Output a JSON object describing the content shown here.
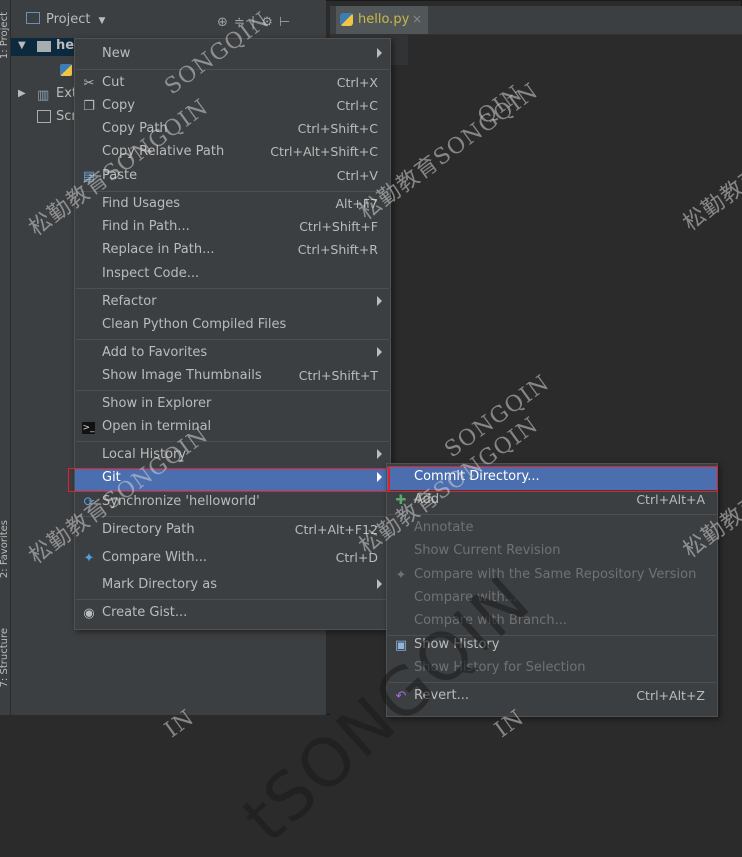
{
  "project_panel": {
    "title": "Project",
    "dropdown_glyph": "▼",
    "side_label_top": "1: Project",
    "side_label_favorites": "2: Favorites",
    "side_label_structure": "7: Structure",
    "tree": [
      {
        "label": "hel",
        "expand": "▼"
      },
      {
        "label": "Ext",
        "expand": "▶"
      },
      {
        "label": "Scr",
        "expand": ""
      }
    ]
  },
  "editor": {
    "tab_label": "hello.py",
    "tab_close": "×"
  },
  "context_menu": {
    "items": [
      {
        "label": "New",
        "shortcut": "",
        "submenu": true,
        "icon": ""
      },
      {
        "label": "Cut",
        "shortcut": "Ctrl+X",
        "icon": "cut-icon"
      },
      {
        "label": "Copy",
        "shortcut": "Ctrl+C",
        "icon": "copy-icon"
      },
      {
        "label": "Copy Path",
        "shortcut": "Ctrl+Shift+C",
        "icon": ""
      },
      {
        "label": "Copy Relative Path",
        "shortcut": "Ctrl+Alt+Shift+C",
        "icon": ""
      },
      {
        "label": "Paste",
        "shortcut": "Ctrl+V",
        "icon": "paste-icon"
      },
      {
        "label": "Find Usages",
        "shortcut": "Alt+F7",
        "icon": ""
      },
      {
        "label": "Find in Path...",
        "shortcut": "Ctrl+Shift+F",
        "icon": ""
      },
      {
        "label": "Replace in Path...",
        "shortcut": "Ctrl+Shift+R",
        "icon": ""
      },
      {
        "label": "Inspect Code...",
        "shortcut": "",
        "icon": ""
      },
      {
        "label": "Refactor",
        "shortcut": "",
        "submenu": true,
        "icon": ""
      },
      {
        "label": "Clean Python Compiled Files",
        "shortcut": "",
        "icon": ""
      },
      {
        "label": "Add to Favorites",
        "shortcut": "",
        "submenu": true,
        "icon": ""
      },
      {
        "label": "Show Image Thumbnails",
        "shortcut": "Ctrl+Shift+T",
        "icon": ""
      },
      {
        "label": "Show in Explorer",
        "shortcut": "",
        "icon": ""
      },
      {
        "label": "Open in terminal",
        "shortcut": "",
        "icon": "terminal-icon"
      },
      {
        "label": "Local History",
        "shortcut": "",
        "submenu": true,
        "icon": ""
      },
      {
        "label": "Git",
        "shortcut": "",
        "submenu": true,
        "icon": "",
        "selected": true
      },
      {
        "label": "Synchronize 'helloworld'",
        "shortcut": "",
        "icon": "sync-icon"
      },
      {
        "label": "Directory Path",
        "shortcut": "Ctrl+Alt+F12",
        "icon": ""
      },
      {
        "label": "Compare With...",
        "shortcut": "Ctrl+D",
        "icon": "compare-icon"
      },
      {
        "label": "Mark Directory as",
        "shortcut": "",
        "submenu": true,
        "icon": ""
      },
      {
        "label": "Create Gist...",
        "shortcut": "",
        "icon": "github-icon"
      }
    ]
  },
  "git_submenu": {
    "items": [
      {
        "label": "Commit Directory...",
        "shortcut": "",
        "selected": true
      },
      {
        "label": "Add",
        "shortcut": "Ctrl+Alt+A",
        "icon": "add-icon"
      },
      {
        "label": "Annotate",
        "shortcut": "",
        "disabled": true
      },
      {
        "label": "Show Current Revision",
        "shortcut": "",
        "disabled": true
      },
      {
        "label": "Compare with the Same Repository Version",
        "shortcut": "",
        "disabled": true
      },
      {
        "label": "Compare with...",
        "shortcut": "",
        "disabled": true
      },
      {
        "label": "Compare with Branch...",
        "shortcut": "",
        "disabled": true
      },
      {
        "label": "Show History",
        "shortcut": "",
        "icon": "history-icon"
      },
      {
        "label": "Show History for Selection",
        "shortcut": "",
        "disabled": true
      },
      {
        "label": "Revert...",
        "shortcut": "Ctrl+Alt+Z",
        "icon": "revert-icon"
      }
    ]
  },
  "watermarks": {
    "small": "松勤教育SONGQIN",
    "partial_a": "SONGQIN",
    "partial_b": "QIN",
    "partial_c": "IN",
    "big": "tSONGQIN"
  },
  "colors": {
    "selection": "#4b6eaf",
    "highlight_outline": "#e0202a",
    "tab_text": "#c9b84c"
  }
}
